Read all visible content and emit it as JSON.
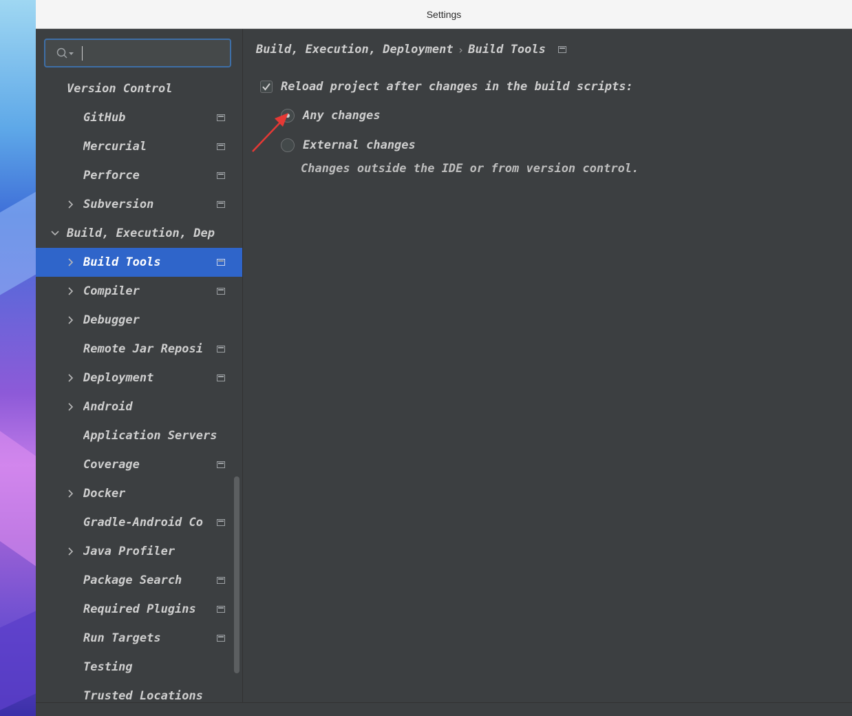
{
  "window": {
    "title": "Settings"
  },
  "search": {
    "placeholder": "",
    "value": ""
  },
  "sidebar": {
    "items": [
      {
        "label": "Version Control",
        "level": 0,
        "expander": "none",
        "project_icon": false
      },
      {
        "label": "GitHub",
        "level": 1,
        "expander": "none",
        "project_icon": true
      },
      {
        "label": "Mercurial",
        "level": 1,
        "expander": "none",
        "project_icon": true
      },
      {
        "label": "Perforce",
        "level": 1,
        "expander": "none",
        "project_icon": true
      },
      {
        "label": "Subversion",
        "level": 1,
        "expander": "collapsed",
        "project_icon": true
      },
      {
        "label": "Build, Execution, Dep",
        "level": 0,
        "expander": "expanded",
        "project_icon": false
      },
      {
        "label": "Build Tools",
        "level": 1,
        "expander": "collapsed",
        "project_icon": true,
        "selected": true
      },
      {
        "label": "Compiler",
        "level": 1,
        "expander": "collapsed",
        "project_icon": true
      },
      {
        "label": "Debugger",
        "level": 1,
        "expander": "collapsed",
        "project_icon": false
      },
      {
        "label": "Remote Jar Reposi",
        "level": 1,
        "expander": "none",
        "project_icon": true
      },
      {
        "label": "Deployment",
        "level": 1,
        "expander": "collapsed",
        "project_icon": true
      },
      {
        "label": "Android",
        "level": 1,
        "expander": "collapsed",
        "project_icon": false
      },
      {
        "label": "Application Servers",
        "level": 1,
        "expander": "none",
        "project_icon": false
      },
      {
        "label": "Coverage",
        "level": 1,
        "expander": "none",
        "project_icon": true
      },
      {
        "label": "Docker",
        "level": 1,
        "expander": "collapsed",
        "project_icon": false
      },
      {
        "label": "Gradle-Android Co",
        "level": 1,
        "expander": "none",
        "project_icon": true
      },
      {
        "label": "Java Profiler",
        "level": 1,
        "expander": "collapsed",
        "project_icon": false
      },
      {
        "label": "Package Search",
        "level": 1,
        "expander": "none",
        "project_icon": true
      },
      {
        "label": "Required Plugins",
        "level": 1,
        "expander": "none",
        "project_icon": true
      },
      {
        "label": "Run Targets",
        "level": 1,
        "expander": "none",
        "project_icon": true
      },
      {
        "label": "Testing",
        "level": 1,
        "expander": "none",
        "project_icon": false
      },
      {
        "label": "Trusted Locations",
        "level": 1,
        "expander": "none",
        "project_icon": false
      }
    ]
  },
  "content": {
    "breadcrumb": {
      "parent": "Build, Execution, Deployment",
      "separator": "›",
      "current": "Build Tools"
    },
    "reload_checkbox": {
      "label": "Reload project after changes in the build scripts:",
      "checked": true
    },
    "radio_any": {
      "label": "Any changes",
      "selected": true
    },
    "radio_external": {
      "label": "External changes",
      "selected": false
    },
    "external_hint": "Changes outside the IDE or from version control."
  },
  "colors": {
    "selection": "#2f65ca",
    "background": "#3c3f41",
    "text": "#cfcfcf",
    "annotation_arrow": "#e53935"
  }
}
